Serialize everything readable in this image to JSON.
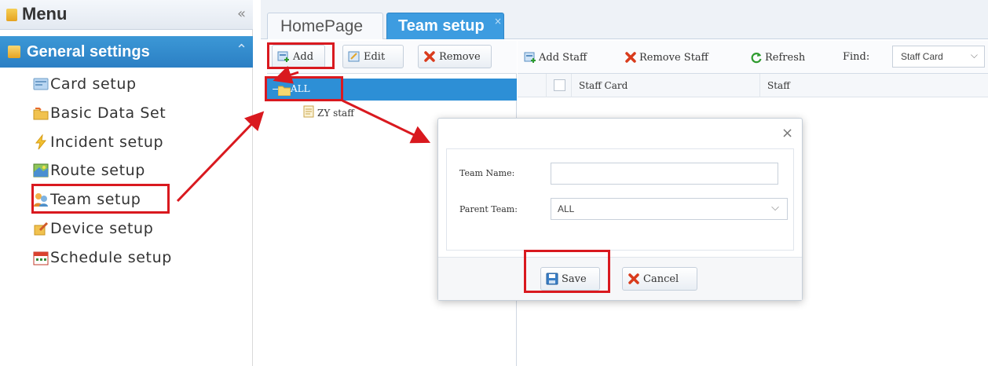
{
  "menu": {
    "title": "Menu",
    "collapse_icon": "«",
    "section_title": "General settings",
    "section_icon": "chevron-up-icon",
    "items": [
      {
        "label": "Card setup",
        "icon": "card-icon"
      },
      {
        "label": "Basic Data Set",
        "icon": "folder-icon"
      },
      {
        "label": "Incident setup",
        "icon": "lightning-icon"
      },
      {
        "label": "Route setup",
        "icon": "map-icon"
      },
      {
        "label": "Team setup",
        "icon": "users-icon"
      },
      {
        "label": "Device setup",
        "icon": "device-icon"
      },
      {
        "label": "Schedule setup",
        "icon": "calendar-icon"
      }
    ]
  },
  "tabs": [
    {
      "label": "HomePage",
      "active": false
    },
    {
      "label": "Team setup",
      "active": true,
      "close": "×"
    }
  ],
  "tree_toolbar": {
    "add_label": "Add",
    "edit_label": "Edit",
    "remove_label": "Remove"
  },
  "tree": {
    "root_label": "ALL",
    "child_label": "ZY staff"
  },
  "staff_toolbar": {
    "add_staff_label": "Add Staff",
    "remove_staff_label": "Remove Staff",
    "refresh_label": "Refresh",
    "find_label": "Find:",
    "find_value": "Staff Card"
  },
  "grid": {
    "columns": [
      "Staff Card",
      "Staff"
    ]
  },
  "dialog": {
    "close": "×",
    "team_name_label": "Team Name:",
    "team_name_value": "",
    "parent_team_label": "Parent Team:",
    "parent_team_value": "ALL",
    "save_label": "Save",
    "cancel_label": "Cancel"
  },
  "colors": {
    "accent": "#2d8fd6",
    "tab_active": "#3d9ce0",
    "highlight": "#d9191f",
    "remove_icon": "#d93b1c"
  }
}
